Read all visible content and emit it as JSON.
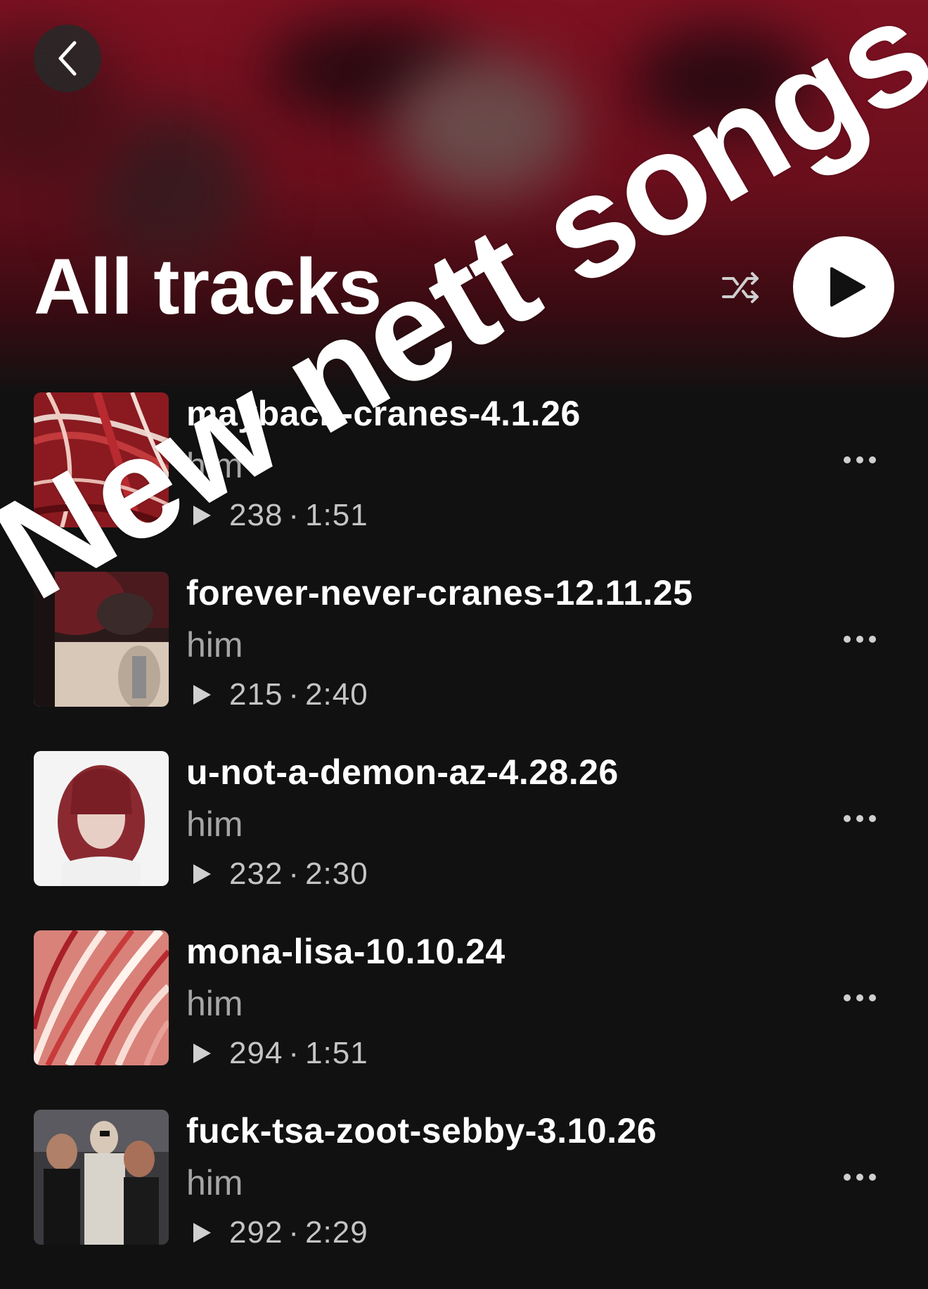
{
  "header": {
    "title": "All tracks",
    "back_icon": "chevron-left-icon",
    "shuffle_icon": "shuffle-icon",
    "play_icon": "play-icon",
    "accent_color": "#7e1122"
  },
  "tracks": [
    {
      "title": "maybach-cranes-4.1.26",
      "artist": "him",
      "plays": "238",
      "separator": "·",
      "duration": "1:51",
      "cover": "red-hair-closeup"
    },
    {
      "title": "forever-never-cranes-12.11.25",
      "artist": "him",
      "plays": "215",
      "separator": "·",
      "duration": "2:40",
      "cover": "photo-dark"
    },
    {
      "title": "u-not-a-demon-az-4.28.26",
      "artist": "him",
      "plays": "232",
      "separator": "·",
      "duration": "2:30",
      "cover": "portrait-red-hair"
    },
    {
      "title": "mona-lisa-10.10.24",
      "artist": "him",
      "plays": "294",
      "separator": "·",
      "duration": "1:51",
      "cover": "red-white-strands"
    },
    {
      "title": "fuck-tsa-zoot-sebby-3.10.26",
      "artist": "him",
      "plays": "292",
      "separator": "·",
      "duration": "2:29",
      "cover": "group-photo"
    }
  ],
  "watermark": "New nett songs"
}
